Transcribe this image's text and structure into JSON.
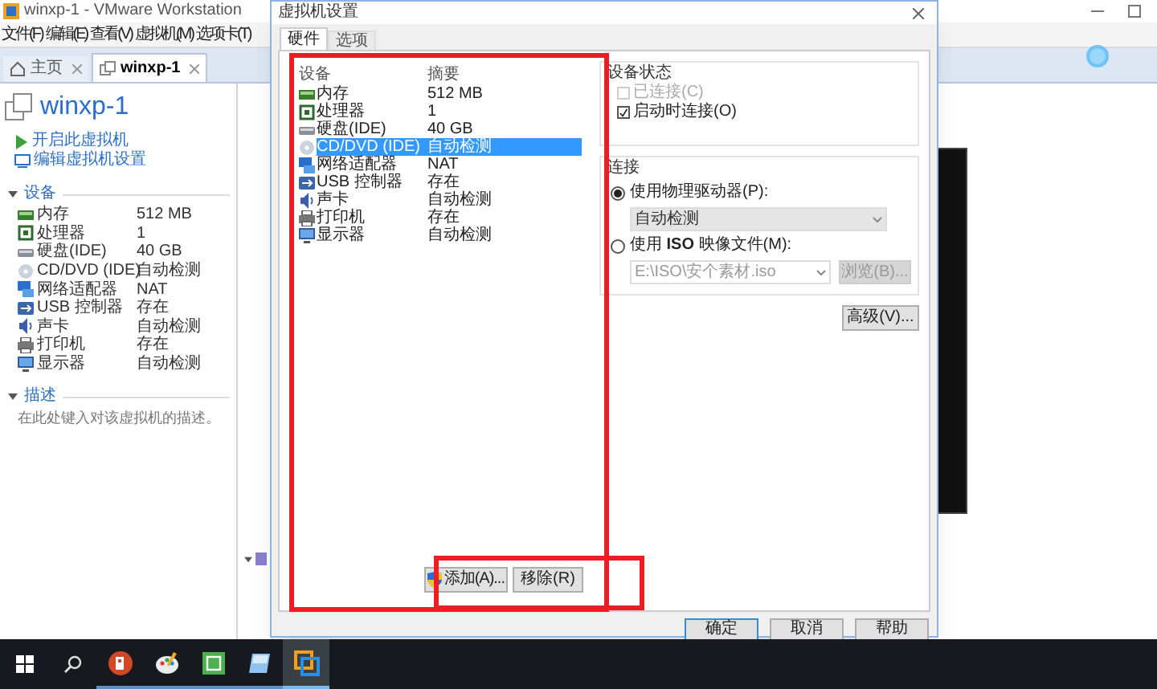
{
  "window": {
    "title": "winxp-1 - VMware Workstation",
    "menu": [
      "文件(F)",
      "编辑(E)",
      "查看(V)",
      "虚拟机(M)",
      "选项卡(T)"
    ]
  },
  "tabs": [
    {
      "label": "主页",
      "selected": false
    },
    {
      "label": "winxp-1",
      "selected": true
    }
  ],
  "vm": {
    "name": "winxp-1",
    "actions": [
      {
        "kind": "power",
        "label": "开启此虚拟机"
      },
      {
        "kind": "edit",
        "label": "编辑虚拟机设置"
      }
    ],
    "devices_section": {
      "title": "设备",
      "expanded": true
    },
    "devices": [
      {
        "kind": "memory",
        "name": "内存",
        "value": "512 MB"
      },
      {
        "kind": "cpu",
        "name": "处理器",
        "value": "1"
      },
      {
        "kind": "disk",
        "name": "硬盘(IDE)",
        "value": "40 GB"
      },
      {
        "kind": "cdrom",
        "name": "CD/DVD (IDE)",
        "value": "自动检测"
      },
      {
        "kind": "network",
        "name": "网络适配器",
        "value": "NAT"
      },
      {
        "kind": "usb",
        "name": "USB 控制器",
        "value": "存在"
      },
      {
        "kind": "sound",
        "name": "声卡",
        "value": "自动检测"
      },
      {
        "kind": "printer",
        "name": "打印机",
        "value": "存在"
      },
      {
        "kind": "display",
        "name": "显示器",
        "value": "自动检测"
      }
    ],
    "description_section": {
      "title": "描述",
      "expanded": true,
      "placeholder": "在此处键入对该虚拟机的描述。"
    }
  },
  "dialog": {
    "title": "虚拟机设置",
    "tabs": [
      {
        "label": "硬件",
        "selected": true
      },
      {
        "label": "选项",
        "selected": false
      }
    ],
    "columns": [
      "设备",
      "摘要"
    ],
    "devices": [
      {
        "kind": "memory",
        "name": "内存",
        "summary": "512 MB",
        "selected": false
      },
      {
        "kind": "cpu",
        "name": "处理器",
        "summary": "1",
        "selected": false
      },
      {
        "kind": "disk",
        "name": "硬盘(IDE)",
        "summary": "40 GB",
        "selected": false
      },
      {
        "kind": "cdrom",
        "name": "CD/DVD (IDE)",
        "summary": "自动检测",
        "selected": true
      },
      {
        "kind": "network",
        "name": "网络适配器",
        "summary": "NAT",
        "selected": false
      },
      {
        "kind": "usb",
        "name": "USB 控制器",
        "summary": "存在",
        "selected": false
      },
      {
        "kind": "sound",
        "name": "声卡",
        "summary": "自动检测",
        "selected": false
      },
      {
        "kind": "printer",
        "name": "打印机",
        "summary": "存在",
        "selected": false
      },
      {
        "kind": "display",
        "name": "显示器",
        "summary": "自动检测",
        "selected": false
      }
    ],
    "add_button": "添加(A)...",
    "remove_button": "移除(R)",
    "device_status": {
      "title": "设备状态",
      "options": [
        {
          "label": "已连接(C)",
          "checked": false,
          "disabled": true
        },
        {
          "label": "启动时连接(O)",
          "checked": true,
          "disabled": false
        }
      ]
    },
    "connection": {
      "title": "连接",
      "options": [
        {
          "label": "使用物理驱动器(P):",
          "selected": true,
          "field": {
            "kind": "dropdown",
            "value": "自动检测",
            "disabled": false
          }
        },
        {
          "label": "使用 **ISO** 映像文件(M):",
          "selected": false,
          "field": {
            "kind": "combo",
            "value": "E:\\ISO\\安个素材.iso",
            "disabled": true
          },
          "button": {
            "label": "浏览(B)...",
            "disabled": true
          }
        }
      ]
    },
    "advanced_button": "高级(V)...",
    "footer_buttons": [
      "确定",
      "取消",
      "帮助"
    ]
  },
  "highlights": {
    "device_list": true,
    "add_remove_buttons": true
  },
  "taskbar": {
    "apps": [
      {
        "kind": "presentation",
        "active": false
      },
      {
        "kind": "paint",
        "active": false
      },
      {
        "kind": "green",
        "active": false
      },
      {
        "kind": "blue",
        "active": false
      },
      {
        "kind": "vmware",
        "active": true
      }
    ]
  }
}
